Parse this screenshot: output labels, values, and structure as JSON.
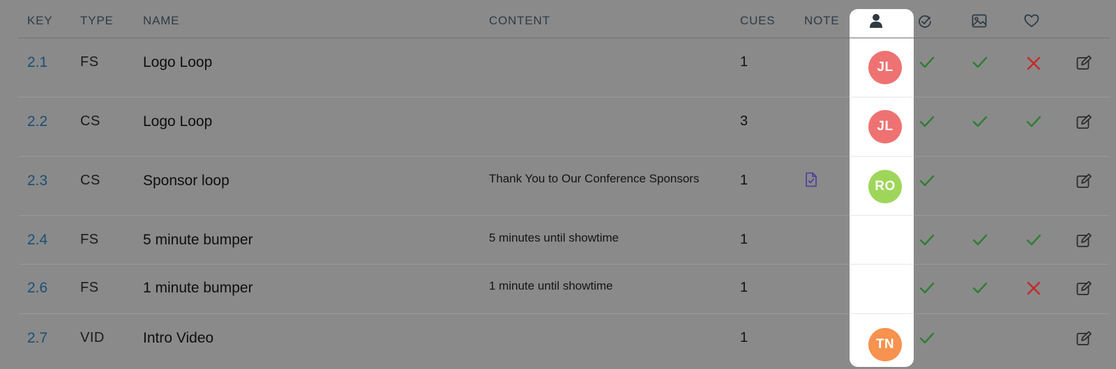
{
  "columns": {
    "key": "KEY",
    "type": "TYPE",
    "name": "NAME",
    "content": "CONTENT",
    "cues": "CUES",
    "note": "NOTE"
  },
  "header_icons": [
    "person-icon",
    "check-circle-icon",
    "image-icon",
    "heart-icon"
  ],
  "colors": {
    "check": "#2e7d32",
    "cross": "#c62828",
    "key_link": "#1c4e74",
    "note_icon": "#4a3b9c"
  },
  "rows": [
    {
      "key": "2.1",
      "type": "FS",
      "name": "Logo Loop",
      "content": "",
      "cues": "1",
      "note": false,
      "avatar": "JL",
      "avatar_color": "#ef7272",
      "status": [
        "check",
        "check",
        "cross"
      ]
    },
    {
      "key": "2.2",
      "type": "CS",
      "name": "Logo Loop",
      "content": "",
      "cues": "3",
      "note": false,
      "avatar": "JL",
      "avatar_color": "#ef7272",
      "status": [
        "check",
        "check",
        "check"
      ]
    },
    {
      "key": "2.3",
      "type": "CS",
      "name": "Sponsor loop",
      "content": "Thank You to Our Conference Sponsors",
      "cues": "1",
      "note": true,
      "avatar": "RO",
      "avatar_color": "#9ed65a",
      "status": [
        "check",
        "",
        ""
      ]
    },
    {
      "key": "2.4",
      "type": "FS",
      "name": "5 minute bumper",
      "content": "5 minutes until showtime",
      "cues": "1",
      "note": false,
      "avatar": "",
      "avatar_color": "",
      "status": [
        "check",
        "check",
        "check"
      ]
    },
    {
      "key": "2.6",
      "type": "FS",
      "name": "1 minute bumper",
      "content": "1 minute until showtime",
      "cues": "1",
      "note": false,
      "avatar": "",
      "avatar_color": "",
      "status": [
        "check",
        "check",
        "cross"
      ]
    },
    {
      "key": "2.7",
      "type": "VID",
      "name": "Intro Video",
      "content": "",
      "cues": "1",
      "note": false,
      "avatar": "TN",
      "avatar_color": "#f7924f",
      "status": [
        "check",
        "",
        ""
      ]
    }
  ]
}
